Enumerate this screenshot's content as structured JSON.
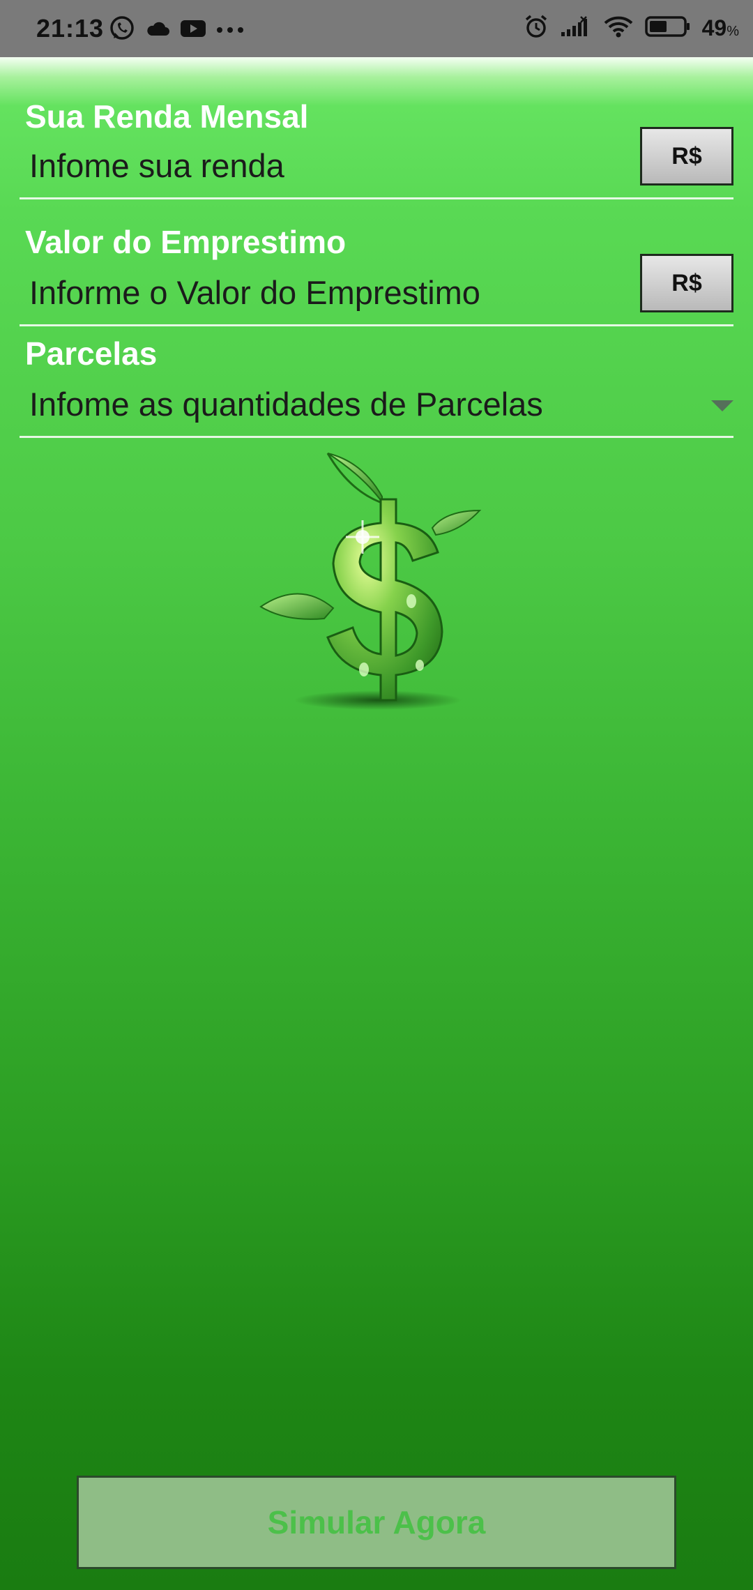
{
  "status_bar": {
    "time": "21:13",
    "battery_percent": "49",
    "battery_unit": "%",
    "icons_left": [
      "whatsapp-icon",
      "cloud-icon",
      "youtube-icon",
      "more-dots-icon"
    ],
    "icons_right": [
      "alarm-icon",
      "signal-icon",
      "wifi-icon",
      "battery-icon"
    ]
  },
  "form": {
    "renda": {
      "label": "Sua Renda Mensal",
      "placeholder": "Infome sua renda",
      "currency_button": "R$"
    },
    "emprestimo": {
      "label": "Valor do Emprestimo",
      "placeholder": "Informe o Valor do Emprestimo",
      "currency_button": "R$"
    },
    "parcelas": {
      "label": "Parcelas",
      "selected": "Infome as quantidades de Parcelas"
    }
  },
  "illustration": {
    "icon": "dollar-plant-icon"
  },
  "actions": {
    "simulate_label": "Simular Agora"
  },
  "colors": {
    "status_bar": "#7a7a7a",
    "background_top": "#64e25f",
    "background_bottom": "#1a7c11",
    "button_fill": "#8fbd86",
    "button_text": "#4cc04a"
  }
}
